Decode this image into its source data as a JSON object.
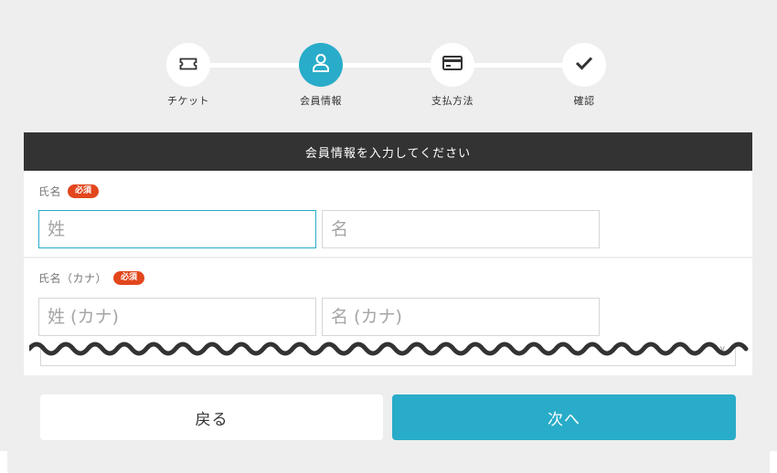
{
  "stepper": {
    "steps": [
      {
        "label": "チケット",
        "icon": "ticket-icon",
        "active": false
      },
      {
        "label": "会員情報",
        "icon": "user-icon",
        "active": true
      },
      {
        "label": "支払方法",
        "icon": "credit-card-icon",
        "active": false
      },
      {
        "label": "確認",
        "icon": "check-icon",
        "active": false
      }
    ]
  },
  "form": {
    "header": "会員情報を入力してください",
    "name": {
      "label": "氏名",
      "required": "必須",
      "last_placeholder": "姓",
      "first_placeholder": "名"
    },
    "kana": {
      "label": "氏名（カナ）",
      "required": "必須",
      "last_placeholder": "姓 (カナ)",
      "first_placeholder": "名 (カナ)"
    }
  },
  "buttons": {
    "back": "戻る",
    "next": "次へ"
  },
  "colors": {
    "accent": "#29acc9",
    "required_badge": "#e2461c",
    "header_bg": "#333333",
    "page_bg": "#eeeeee"
  }
}
